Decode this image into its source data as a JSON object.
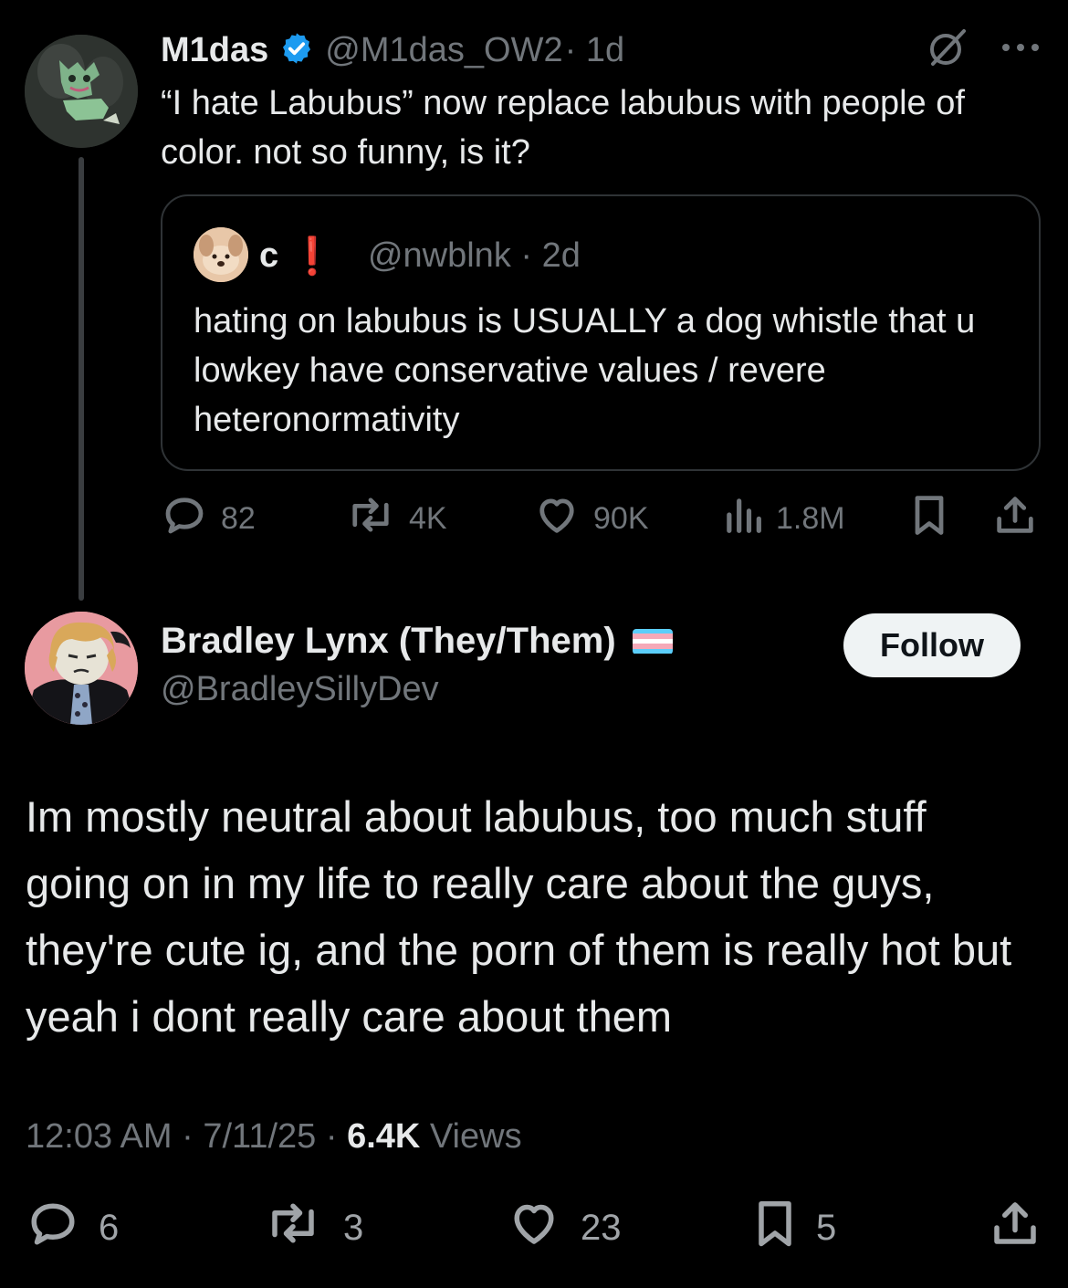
{
  "parent_tweet": {
    "display_name": "M1das",
    "handle": "@M1das_OW2",
    "time": "· 1d",
    "text": "“I hate Labubus” now replace labubus with people of color. not so funny, is it?",
    "quote": {
      "display_name": "c",
      "badge": "❗",
      "handle": "@nwblnk · 2d",
      "text": "hating on labubus is USUALLY a dog whistle that u lowkey have conservative values / revere heteronormativity"
    },
    "stats": {
      "replies": "82",
      "reposts": "4K",
      "likes": "90K",
      "views": "1.8M"
    }
  },
  "main_tweet": {
    "display_name": "Bradley Lynx (They/Them)",
    "handle": "@BradleySillyDev",
    "follow_label": "Follow",
    "text": "Im mostly neutral about labubus, too much stuff going on in my life to really care about the guys, they're cute ig, and the porn of them is really hot but yeah i dont really care about them",
    "timestamp": "12:03 AM · 7/11/25 · ",
    "views_count": "6.4K",
    "views_label": " Views",
    "stats": {
      "replies": "6",
      "reposts": "3",
      "likes": "23",
      "bookmarks": "5"
    }
  },
  "colors": {
    "background": "#000000",
    "text": "#e7e9ea",
    "muted": "#71767b",
    "verified": "#1d9bf0",
    "alert": "#f4212e"
  },
  "icons": [
    "verified-badge-icon",
    "grok-icon",
    "more-icon",
    "reply-icon",
    "repost-icon",
    "like-icon",
    "views-icon",
    "bookmark-icon",
    "share-icon",
    "trans-flag-icon"
  ]
}
